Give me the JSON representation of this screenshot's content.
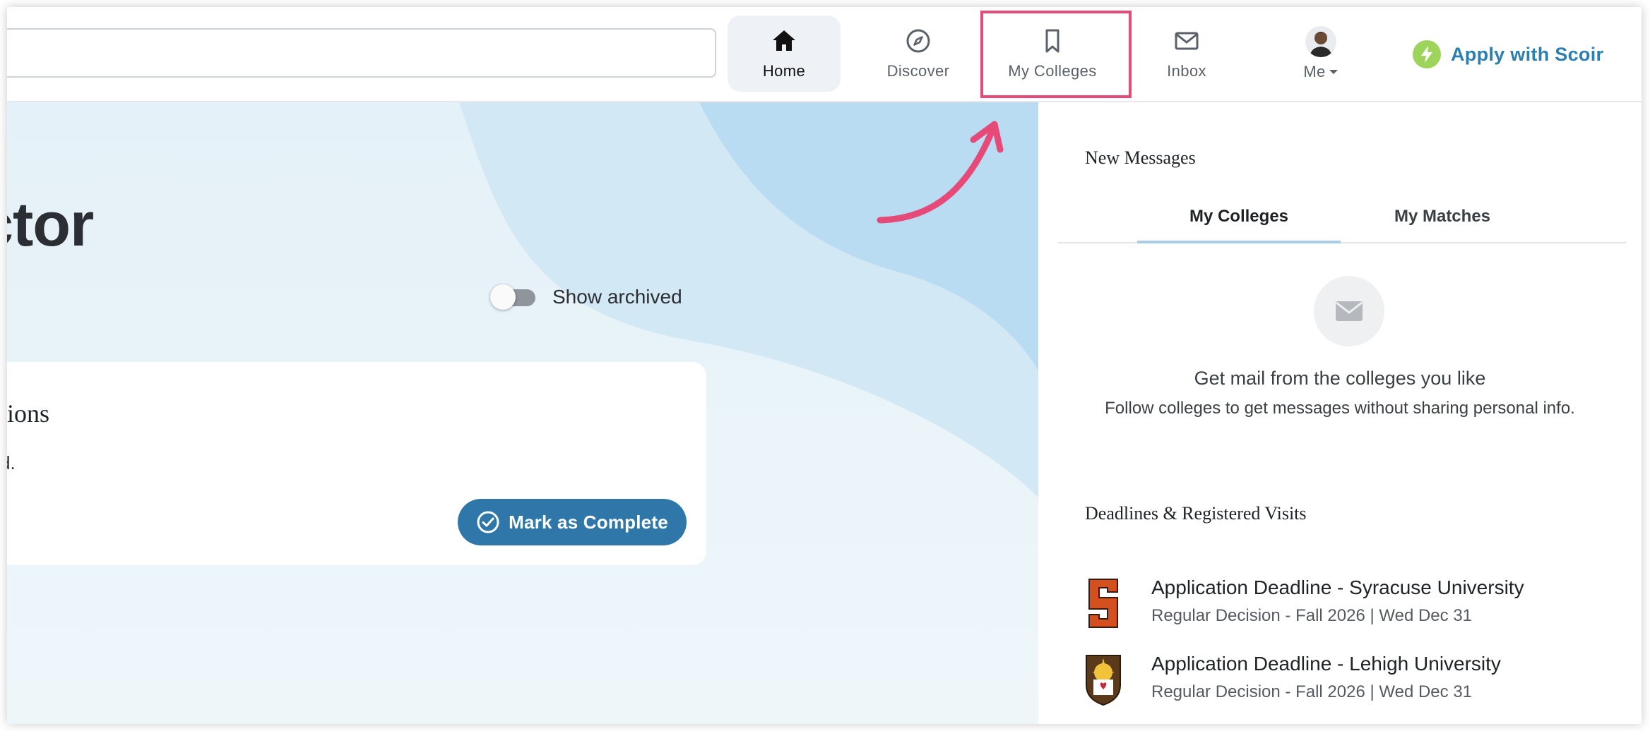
{
  "nav": {
    "search": {
      "placeholder": ""
    },
    "items": [
      {
        "label": "Home",
        "icon": "home-icon"
      },
      {
        "label": "Discover",
        "icon": "compass-icon"
      },
      {
        "label": "My Colleges",
        "icon": "bookmark-icon"
      },
      {
        "label": "Inbox",
        "icon": "mail-icon"
      },
      {
        "label": "Me",
        "icon": "avatar"
      }
    ],
    "apply_label": "Apply with Scoir",
    "colors": {
      "accent": "#2d7fb0",
      "highlight": "#e64a79",
      "apply_icon": "#9fd45c"
    }
  },
  "hero": {
    "title": "ctor",
    "toggle_label": "Show archived",
    "task": {
      "title": "tions",
      "desc": "d.",
      "complete_label": "Mark as Complete"
    }
  },
  "panel": {
    "messages_title": "New Messages",
    "tabs": [
      {
        "label": "My Colleges",
        "active": true
      },
      {
        "label": "My Matches",
        "active": false
      }
    ],
    "empty_title": "Get mail from the colleges you like",
    "empty_sub": "Follow colleges to get messages without sharing personal info.",
    "deadlines_title": "Deadlines & Registered Visits",
    "deadlines": [
      {
        "title": "Application Deadline - Syracuse University",
        "sub": "Regular Decision - Fall 2026 | Wed Dec 31",
        "logo": "syracuse-logo"
      },
      {
        "title": "Application Deadline - Lehigh University",
        "sub": "Regular Decision - Fall 2026 | Wed Dec 31",
        "logo": "lehigh-logo"
      }
    ]
  }
}
